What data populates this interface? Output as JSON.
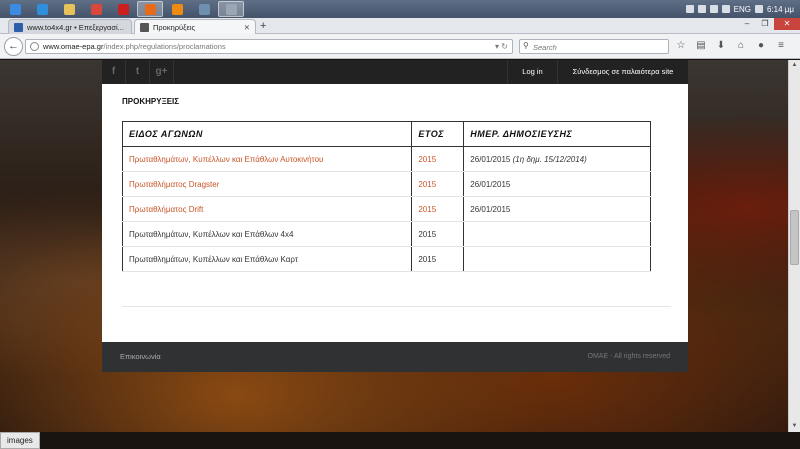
{
  "taskbar": {
    "items": [
      {
        "name": "start-icon",
        "color": "#3b8be0",
        "active": false
      },
      {
        "name": "ie-icon",
        "color": "#2f8fdc",
        "active": false
      },
      {
        "name": "explorer-icon",
        "color": "#e7c15a",
        "active": false
      },
      {
        "name": "chrome-icon",
        "color": "#d9463a",
        "active": false
      },
      {
        "name": "opera-icon",
        "color": "#cc1f1f",
        "active": false
      },
      {
        "name": "firefox-icon",
        "color": "#e66c1c",
        "active": true
      },
      {
        "name": "vlc-icon",
        "color": "#f08a12",
        "active": false
      },
      {
        "name": "app-icon",
        "color": "#6d8fb0",
        "active": false
      },
      {
        "name": "app2-icon",
        "color": "#9aa6b4",
        "active": true
      }
    ],
    "lang": "ENG",
    "time": "6:14 μμ"
  },
  "browser": {
    "tabs": [
      {
        "title": "www.to4x4.gr • Επεξεργασί...",
        "active": false,
        "favicon_color": "#2d5fa8"
      },
      {
        "title": "Προκηρύξεις",
        "active": true,
        "favicon_color": "#555555"
      }
    ],
    "new_tab": "+",
    "url_host": "www.omae-epa.gr",
    "url_path": "/index.php/regulations/proclamations",
    "search_placeholder": "Search",
    "status": "images"
  },
  "site": {
    "social": [
      "f",
      "t",
      "g+"
    ],
    "login": "Log in",
    "old_site": "Σύνδεσμος σε παλαιότερα site",
    "page_title": "ΠΡΟΚΗΡΥΞΕΙΣ",
    "table": {
      "headers": [
        "ΕΙΔΟΣ ΑΓΩΝΩΝ",
        "ΕΤΟΣ",
        "ΗΜΕΡ. ΔΗΜΟΣΙΕΥΣΗΣ"
      ],
      "rows": [
        {
          "title": "Πρωταθλημάτων, Κυπέλλων και Επάθλων Αυτοκινήτου",
          "year": "2015",
          "date": "26/01/2015",
          "note": "(1η δημ. 15/12/2014)",
          "link": true
        },
        {
          "title": "Πρωταθλήματος Dragster",
          "year": "2015",
          "date": "26/01/2015",
          "note": "",
          "link": true
        },
        {
          "title": "Πρωταθλήματος Drift",
          "year": "2015",
          "date": "26/01/2015",
          "note": "",
          "link": true
        },
        {
          "title": "Πρωταθλημάτων, Κυπέλλων και Επάθλων 4x4",
          "year": "2015",
          "date": "",
          "note": "",
          "link": false
        },
        {
          "title": "Πρωταθλημάτων, Κυπέλλων και Επάθλων Καρτ",
          "year": "2015",
          "date": "",
          "note": "",
          "link": false
        }
      ]
    },
    "footer_left": "Επικοινωνία",
    "footer_right": "OMAE - All rights reserved"
  }
}
